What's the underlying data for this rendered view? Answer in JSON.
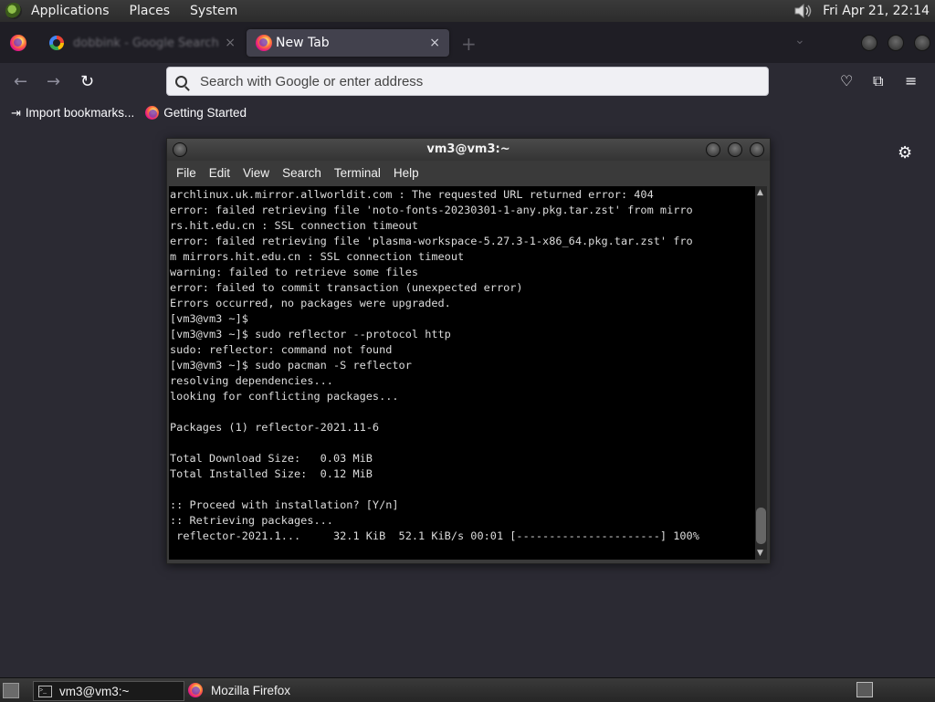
{
  "top_panel": {
    "menus": [
      "Applications",
      "Places",
      "System"
    ],
    "clock": "Fri Apr 21, 22:14"
  },
  "browser": {
    "tabs": [
      {
        "title": "dobbink - Google Search",
        "active": false
      },
      {
        "title": "New Tab",
        "active": true
      }
    ],
    "close_glyph": "×",
    "newtab_glyph": "+",
    "tablist_glyph": "⌄",
    "url_placeholder": "Search with Google or enter address",
    "bookmarks": [
      {
        "label": "Import bookmarks...",
        "icon": "import-icon"
      },
      {
        "label": "Getting Started",
        "icon": "firefox-icon"
      }
    ],
    "nav_icons": {
      "back": "←",
      "forward": "→",
      "reload": "↻",
      "pocket": "♡",
      "extensions": "⧉",
      "menu": "≡",
      "settings": "⚙"
    }
  },
  "terminal": {
    "title": "vm3@vm3:~",
    "menus": [
      "File",
      "Edit",
      "View",
      "Search",
      "Terminal",
      "Help"
    ],
    "lines": [
      "archlinux.uk.mirror.allworldit.com : The requested URL returned error: 404",
      "error: failed retrieving file 'noto-fonts-20230301-1-any.pkg.tar.zst' from mirro",
      "rs.hit.edu.cn : SSL connection timeout",
      "error: failed retrieving file 'plasma-workspace-5.27.3-1-x86_64.pkg.tar.zst' fro",
      "m mirrors.hit.edu.cn : SSL connection timeout",
      "warning: failed to retrieve some files",
      "error: failed to commit transaction (unexpected error)",
      "Errors occurred, no packages were upgraded.",
      "[vm3@vm3 ~]$",
      "[vm3@vm3 ~]$ sudo reflector --protocol http",
      "sudo: reflector: command not found",
      "[vm3@vm3 ~]$ sudo pacman -S reflector",
      "resolving dependencies...",
      "looking for conflicting packages...",
      "",
      "Packages (1) reflector-2021.11-6",
      "",
      "Total Download Size:   0.03 MiB",
      "Total Installed Size:  0.12 MiB",
      "",
      ":: Proceed with installation? [Y/n]",
      ":: Retrieving packages...",
      " reflector-2021.1...     32.1 KiB  52.1 KiB/s 00:01 [----------------------] 100%"
    ]
  },
  "taskbar": {
    "tasks": [
      {
        "label": "vm3@vm3:~",
        "icon": "terminal-icon",
        "active": true
      },
      {
        "label": "Mozilla Firefox",
        "icon": "firefox-icon",
        "active": false
      }
    ]
  }
}
